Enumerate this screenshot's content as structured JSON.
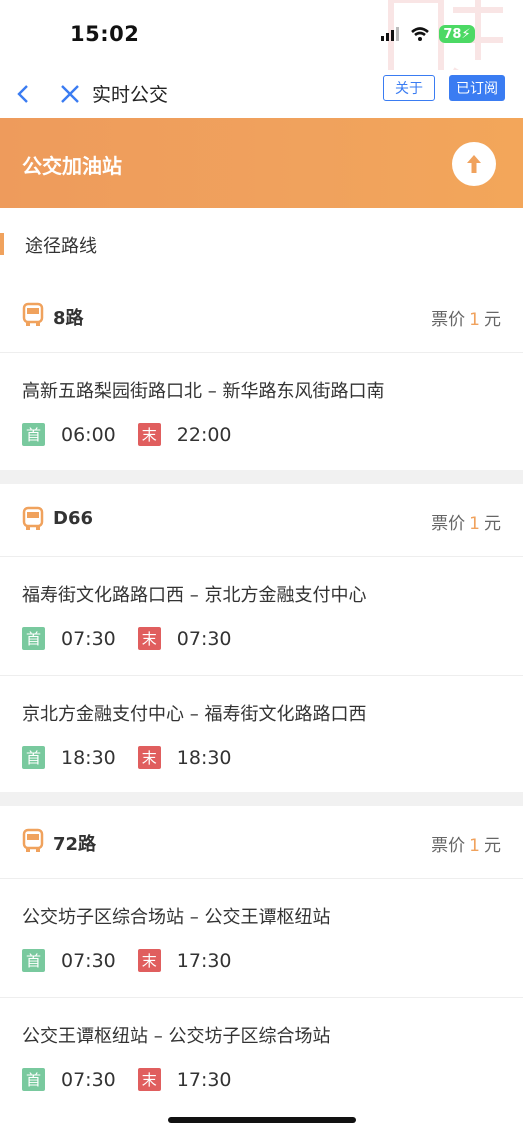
{
  "status": {
    "time": "15:02",
    "battery": "78"
  },
  "nav": {
    "title": "实时公交",
    "about_label": "关于",
    "subscribed_label": "已订阅"
  },
  "banner": {
    "title": "公交加油站"
  },
  "section": {
    "title": "途径路线"
  },
  "fare_prefix": "票价",
  "fare_suffix": "元",
  "first_label": "首",
  "last_label": "末",
  "routes": [
    {
      "name": "8路",
      "fare": "1",
      "trips": [
        {
          "direction": "高新五路梨园街路口北 – 新华路东风街路口南",
          "first": "06:00",
          "last": "22:00"
        }
      ]
    },
    {
      "name": "D66",
      "fare": "1",
      "trips": [
        {
          "direction": "福寿街文化路路口西 – 京北方金融支付中心",
          "first": "07:30",
          "last": "07:30"
        },
        {
          "direction": "京北方金融支付中心 – 福寿街文化路路口西",
          "first": "18:30",
          "last": "18:30"
        }
      ]
    },
    {
      "name": "72路",
      "fare": "1",
      "trips": [
        {
          "direction": "公交坊子区综合场站 – 公交王谭枢纽站",
          "first": "07:30",
          "last": "17:30"
        },
        {
          "direction": "公交王谭枢纽站 – 公交坊子区综合场站",
          "first": "07:30",
          "last": "17:30"
        }
      ]
    }
  ],
  "colors": {
    "accent": "#f0a25d",
    "primary_blue": "#3a7cf2",
    "first_tag": "#79c99e",
    "last_tag": "#e05e5e"
  },
  "icons": {
    "back": "chevron-left-icon",
    "close": "close-icon",
    "banner": "arrow-up-icon",
    "bus": "bus-icon"
  }
}
